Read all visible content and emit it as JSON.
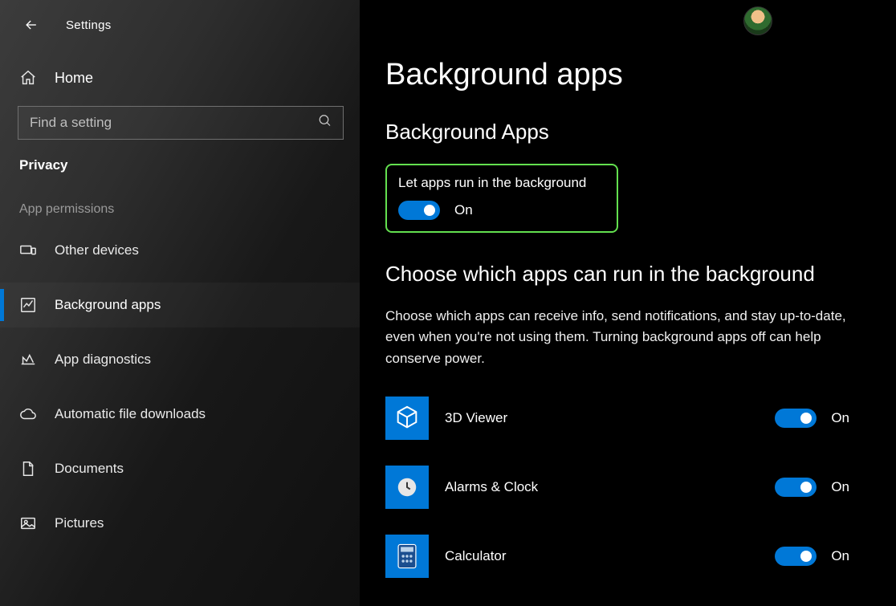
{
  "header": {
    "title": "Settings"
  },
  "sidebar": {
    "home_label": "Home",
    "search_placeholder": "Find a setting",
    "category_label": "Privacy",
    "section_label": "App permissions",
    "items": [
      {
        "label": "Other devices"
      },
      {
        "label": "Background apps"
      },
      {
        "label": "App diagnostics"
      },
      {
        "label": "Automatic file downloads"
      },
      {
        "label": "Documents"
      },
      {
        "label": "Pictures"
      }
    ]
  },
  "content": {
    "page_title": "Background apps",
    "section1_title": "Background Apps",
    "master_toggle": {
      "label": "Let apps run in the background",
      "state": "On"
    },
    "section2_title": "Choose which apps can run in the background",
    "section2_body": "Choose which apps can receive info, send notifications, and stay up-to-date, even when you're not using them. Turning background apps off can help conserve power.",
    "apps": [
      {
        "name": "3D Viewer",
        "state": "On"
      },
      {
        "name": "Alarms & Clock",
        "state": "On"
      },
      {
        "name": "Calculator",
        "state": "On"
      }
    ]
  }
}
